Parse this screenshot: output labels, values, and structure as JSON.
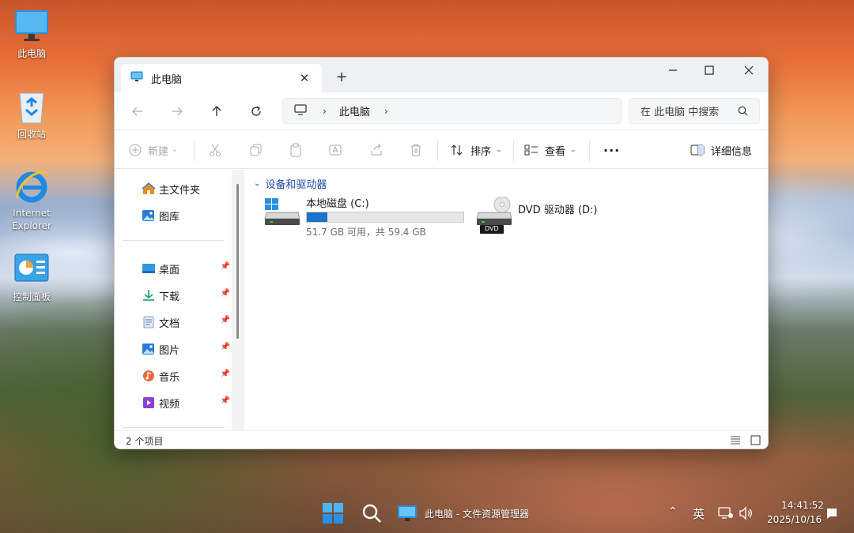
{
  "desktop": {
    "icons": [
      {
        "label": "此电脑",
        "icon": "monitor-icon"
      },
      {
        "label": "回收站",
        "icon": "recycle-bin-icon"
      },
      {
        "label": "Internet Explorer",
        "icon": "internet-explorer-icon"
      },
      {
        "label": "控制面板",
        "icon": "control-panel-icon"
      }
    ]
  },
  "window": {
    "tab_title": "此电脑",
    "new_tab_symbol": "+",
    "address": {
      "segment": "此电脑"
    },
    "search": {
      "placeholder": "在 此电脑 中搜索"
    },
    "toolbar": {
      "new_label": "新建",
      "sort_label": "排序",
      "view_label": "查看",
      "more_label": "···",
      "details_label": "详细信息"
    },
    "sidebar": {
      "items": [
        {
          "label": "主文件夹",
          "icon": "home-icon",
          "pinned": false
        },
        {
          "label": "图库",
          "icon": "gallery-icon",
          "pinned": false
        },
        {
          "label": "桌面",
          "icon": "desktop-icon",
          "pinned": true
        },
        {
          "label": "下载",
          "icon": "download-icon",
          "pinned": true
        },
        {
          "label": "文档",
          "icon": "document-icon",
          "pinned": true
        },
        {
          "label": "图片",
          "icon": "pictures-icon",
          "pinned": true
        },
        {
          "label": "音乐",
          "icon": "music-icon",
          "pinned": true
        },
        {
          "label": "视频",
          "icon": "video-icon",
          "pinned": true
        }
      ]
    },
    "content": {
      "group_header": "设备和驱动器",
      "drives": [
        {
          "name": "本地磁盘 (C:)",
          "space_text": "51.7 GB 可用，共 59.4 GB",
          "used_fraction": 0.13,
          "icon": "hard-drive-icon"
        },
        {
          "name": "DVD 驱动器 (D:)",
          "icon": "dvd-drive-icon",
          "badge": "DVD"
        }
      ]
    },
    "status": {
      "item_count": "2 个项目"
    }
  },
  "taskbar": {
    "task_title": "此电脑 - 文件资源管理器",
    "ime": "英",
    "time": "14:41:52",
    "date": "2025/10/16"
  },
  "colors": {
    "accent": "#1a73c8",
    "link": "#1f4aa8"
  }
}
